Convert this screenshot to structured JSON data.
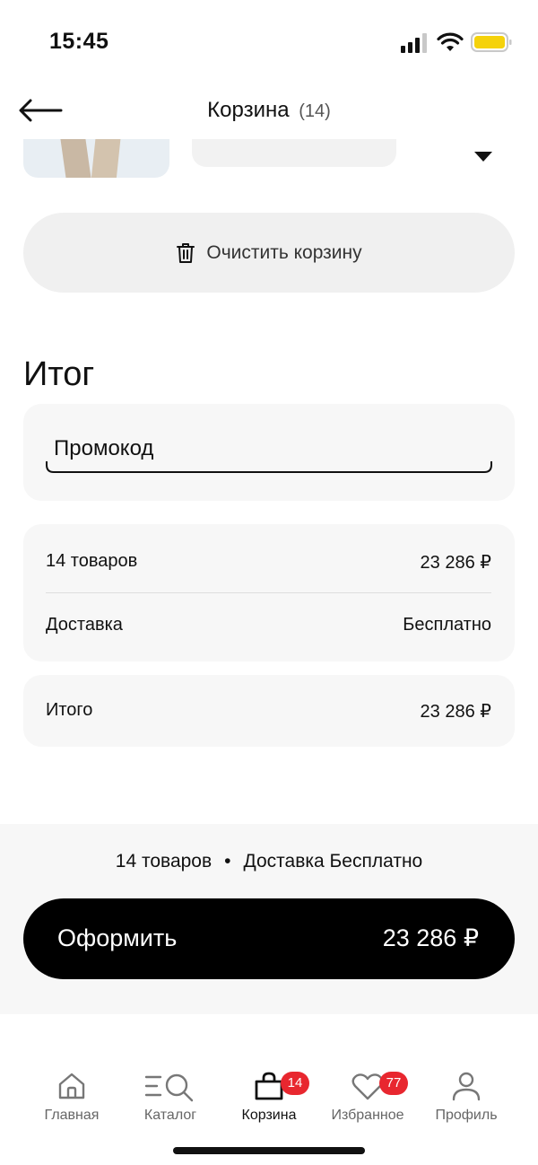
{
  "status_bar": {
    "time": "15:45"
  },
  "header": {
    "title": "Корзина",
    "count": "(14)"
  },
  "actions": {
    "clear_cart_label": "Очистить корзину"
  },
  "summary": {
    "title": "Итог",
    "promo_label": "Промокод",
    "items_label": "14 товаров",
    "items_price": "23 286 ₽",
    "delivery_label": "Доставка",
    "delivery_value": "Бесплатно",
    "total_label": "Итого",
    "total_price": "23 286 ₽"
  },
  "checkout": {
    "info_items": "14 товаров",
    "info_separator": "•",
    "info_delivery": "Доставка Бесплатно",
    "button_label": "Оформить",
    "button_price": "23 286 ₽"
  },
  "nav": {
    "items": [
      {
        "label": "Главная",
        "icon": "home-icon"
      },
      {
        "label": "Каталог",
        "icon": "catalog-search-icon"
      },
      {
        "label": "Корзина",
        "icon": "bag-icon",
        "badge": "14"
      },
      {
        "label": "Избранное",
        "icon": "heart-icon",
        "badge": "77"
      },
      {
        "label": "Профиль",
        "icon": "profile-icon"
      }
    ],
    "active_index": 2,
    "badge_color": "#e8272f"
  },
  "colors": {
    "checkout_button": "#000000",
    "card_background": "#f7f7f7",
    "battery": "#f5d20b"
  }
}
